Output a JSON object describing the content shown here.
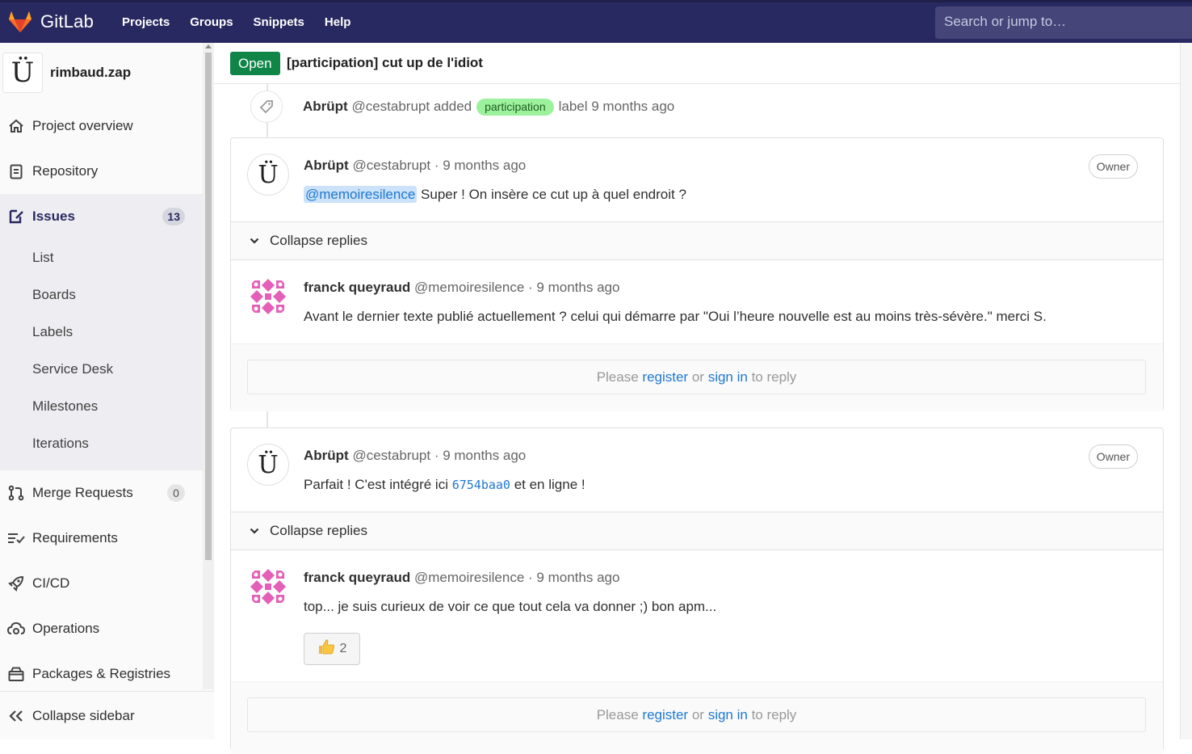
{
  "navbar": {
    "brand": "GitLab",
    "links": [
      "Projects",
      "Groups",
      "Snippets",
      "Help"
    ],
    "search_placeholder": "Search or jump to…"
  },
  "sidebar": {
    "project_avatar": "Ü",
    "project_name": "rimbaud.zap",
    "items": [
      {
        "label": "Project overview",
        "icon": "home-icon"
      },
      {
        "label": "Repository",
        "icon": "doc-icon"
      },
      {
        "label": "Issues",
        "icon": "issues-icon",
        "count": "13"
      },
      {
        "label": "Merge Requests",
        "icon": "merge-request-icon",
        "count": "0"
      },
      {
        "label": "Requirements",
        "icon": "requirements-icon"
      },
      {
        "label": "CI/CD",
        "icon": "rocket-icon"
      },
      {
        "label": "Operations",
        "icon": "cloud-gear-icon"
      },
      {
        "label": "Packages & Registries",
        "icon": "package-icon"
      }
    ],
    "issue_subitems": [
      "List",
      "Boards",
      "Labels",
      "Service Desk",
      "Milestones",
      "Iterations"
    ],
    "collapse_label": "Collapse sidebar"
  },
  "issue": {
    "status": "Open",
    "title": "[participation] cut up de l'idiot"
  },
  "system_note": {
    "author": "Abrüpt",
    "handle": "@cestabrupt",
    "action": "added",
    "label": "participation",
    "suffix": "label 9 months ago"
  },
  "threads": [
    {
      "author": "Abrüpt",
      "handle": "@cestabrupt",
      "time": "· 9 months ago",
      "badge": "Owner",
      "mention": "@memoiresilence",
      "body": "Super ! On insère ce cut up à quel endroit ?",
      "collapse_label": "Collapse replies",
      "reply": {
        "author": "franck queyraud",
        "handle": "@memoiresilence",
        "time": "· 9 months ago",
        "body": "Avant le dernier texte publié actuellement ? celui qui démarre par \"Oui l’heure nouvelle est au moins très-sévère.\" merci S."
      }
    },
    {
      "author": "Abrüpt",
      "handle": "@cestabrupt",
      "time": "· 9 months ago",
      "badge": "Owner",
      "body_before": "Parfait ! C'est intégré ici",
      "commit": "6754baa0",
      "body_after": "et en ligne !",
      "collapse_label": "Collapse replies",
      "reply": {
        "author": "franck queyraud",
        "handle": "@memoiresilence",
        "time": "· 9 months ago",
        "body": "top... je suis curieux de voir ce que tout cela va donner ;) bon apm...",
        "award_count": "2"
      }
    }
  ],
  "reply_prompt": {
    "please": "Please",
    "register": "register",
    "or": "or",
    "sign_in": "sign in",
    "to_reply": "to reply"
  },
  "colors": {
    "navbar": "#292961",
    "open_badge": "#108548",
    "label": "#9cf29c",
    "link": "#1f78d1"
  }
}
